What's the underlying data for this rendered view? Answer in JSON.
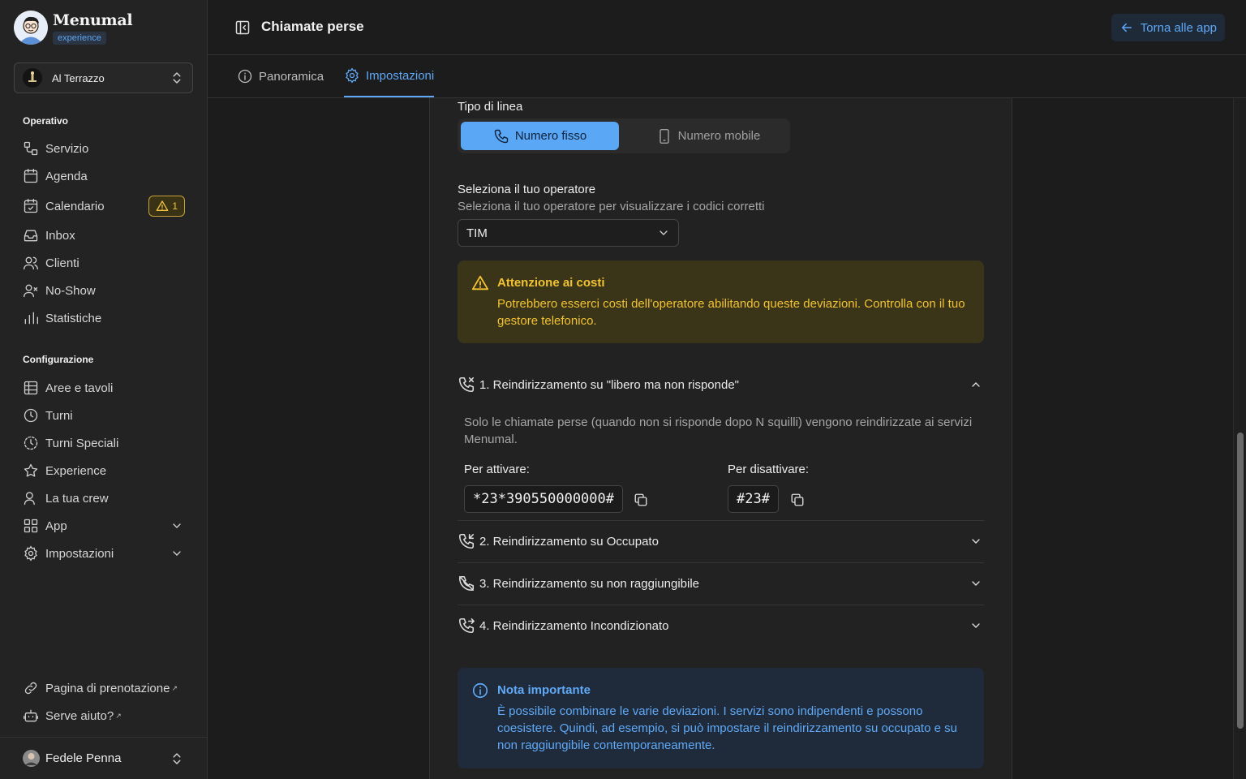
{
  "brand": {
    "name": "Menumal",
    "badge": "experience"
  },
  "venue": {
    "name": "Al Terrazzo"
  },
  "sidebar": {
    "section_operativo": "Operativo",
    "section_configurazione": "Configurazione",
    "operativo": [
      {
        "label": "Servizio",
        "icon": "service-icon"
      },
      {
        "label": "Agenda",
        "icon": "calendar-icon"
      },
      {
        "label": "Calendario",
        "icon": "calendar-check-icon",
        "badge": "1"
      },
      {
        "label": "Inbox",
        "icon": "inbox-icon"
      },
      {
        "label": "Clienti",
        "icon": "users-icon"
      },
      {
        "label": "No-Show",
        "icon": "user-x-icon"
      },
      {
        "label": "Statistiche",
        "icon": "bar-chart-icon"
      }
    ],
    "configurazione": [
      {
        "label": "Aree e tavoli",
        "icon": "table-icon"
      },
      {
        "label": "Turni",
        "icon": "clock-icon"
      },
      {
        "label": "Turni Speciali",
        "icon": "clock-dashed-icon"
      },
      {
        "label": "Experience",
        "icon": "star-icon"
      },
      {
        "label": "La tua crew",
        "icon": "crew-icon"
      },
      {
        "label": "App",
        "icon": "grid-icon"
      },
      {
        "label": "Impostazioni",
        "icon": "gear-icon"
      }
    ],
    "footer": [
      {
        "label": "Pagina di prenotazione",
        "icon": "link-icon"
      },
      {
        "label": "Serve aiuto?",
        "icon": "bot-icon"
      }
    ],
    "ext_mark": "↗"
  },
  "user": {
    "name": "Fedele Penna"
  },
  "header": {
    "title": "Chiamate perse",
    "back_label": "Torna alle app"
  },
  "tabs": [
    {
      "label": "Panoramica",
      "active": false
    },
    {
      "label": "Impostazioni",
      "active": true
    }
  ],
  "settings": {
    "line_type_label": "Tipo di linea",
    "line_fixed": "Numero fisso",
    "line_mobile": "Numero mobile",
    "operator_label": "Seleziona il tuo operatore",
    "operator_help": "Seleziona il tuo operatore per visualizzare i codici corretti",
    "operator_value": "TIM",
    "cost_alert_title": "Attenzione ai costi",
    "cost_alert_body": "Potrebbero esserci costi dell'operatore abilitando queste deviazioni. Controlla con il tuo gestore telefonico.",
    "redirects": [
      {
        "title": "1. Reindirizzamento su \"libero ma non risponde\"",
        "expanded": true,
        "description": "Solo le chiamate perse (quando non si risponde dopo N squilli) vengono reindirizzate ai servizi Menumal.",
        "activate_label": "Per attivare:",
        "activate_code": "*23*390550000000#",
        "deactivate_label": "Per disattivare:",
        "deactivate_code": "#23#"
      },
      {
        "title": "2. Reindirizzamento su Occupato",
        "expanded": false
      },
      {
        "title": "3. Reindirizzamento su non raggiungibile",
        "expanded": false
      },
      {
        "title": "4. Reindirizzamento Incondizionato",
        "expanded": false
      }
    ],
    "note_title": "Nota importante",
    "note_body": "È possibile combinare le varie deviazioni. I servizi sono indipendenti e possono coesistere. Quindi, ad esempio, si può impostare il reindirizzamento su occupato e su non raggiungibile contemporaneamente."
  },
  "colors": {
    "accent": "#5ea8f7",
    "warning": "#f2c233",
    "background": "#1c1c1c",
    "sidebar": "#232323"
  }
}
